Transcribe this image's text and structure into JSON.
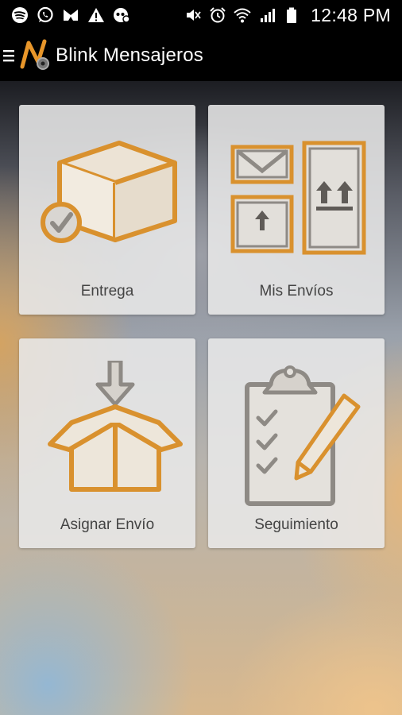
{
  "status_bar": {
    "time": "12:48 PM",
    "left_icons": [
      "spotify-icon",
      "whatsapp-icon",
      "mail-app-icon",
      "warning-icon",
      "voicemail-icon"
    ],
    "right_icons": [
      "mute-icon",
      "alarm-icon",
      "wifi-icon",
      "signal-icon",
      "battery-icon"
    ]
  },
  "app_bar": {
    "title": "Blink Mensajeros"
  },
  "tiles": [
    {
      "label": "Entrega",
      "icon": "box-check-icon"
    },
    {
      "label": "Mis Envíos",
      "icon": "packages-icon"
    },
    {
      "label": "Asignar Envío",
      "icon": "open-box-arrow-icon"
    },
    {
      "label": "Seguimiento",
      "icon": "clipboard-pencil-icon"
    }
  ],
  "colors": {
    "accent": "#D9912E",
    "icon_gray": "#8E8A85",
    "card_bg": "#E8E8E8",
    "bar_bg": "#000000"
  }
}
